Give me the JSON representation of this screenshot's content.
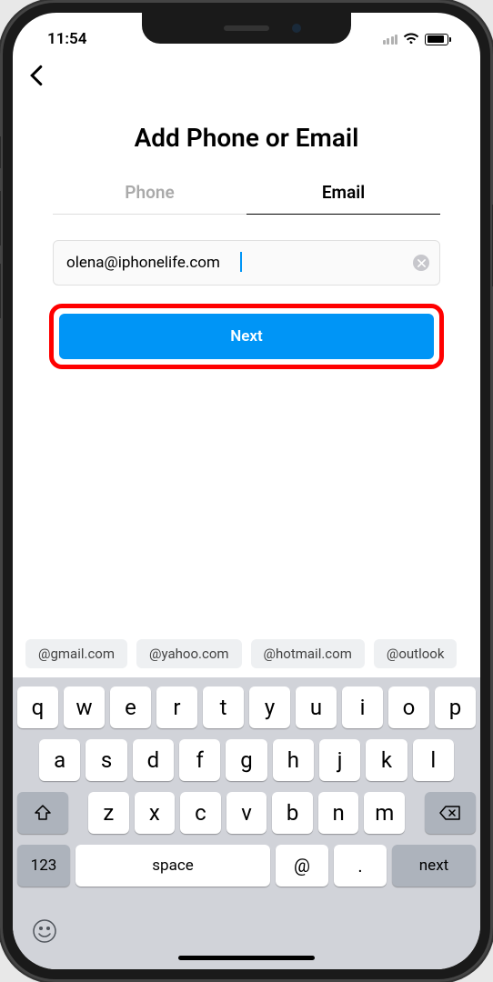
{
  "status": {
    "time": "11:54"
  },
  "nav": {
    "title": "Add Phone or Email"
  },
  "tabs": {
    "phone": "Phone",
    "email": "Email"
  },
  "form": {
    "email_value": "olena@iphonelife.com",
    "next_label": "Next"
  },
  "suggestions": [
    "@gmail.com",
    "@yahoo.com",
    "@hotmail.com",
    "@outlook"
  ],
  "keyboard": {
    "row1": [
      "q",
      "w",
      "e",
      "r",
      "t",
      "y",
      "u",
      "i",
      "o",
      "p"
    ],
    "row2": [
      "a",
      "s",
      "d",
      "f",
      "g",
      "h",
      "j",
      "k",
      "l"
    ],
    "row3": [
      "z",
      "x",
      "c",
      "v",
      "b",
      "n",
      "m"
    ],
    "num_label": "123",
    "space_label": "space",
    "at_label": "@",
    "dot_label": ".",
    "next_label": "next"
  }
}
